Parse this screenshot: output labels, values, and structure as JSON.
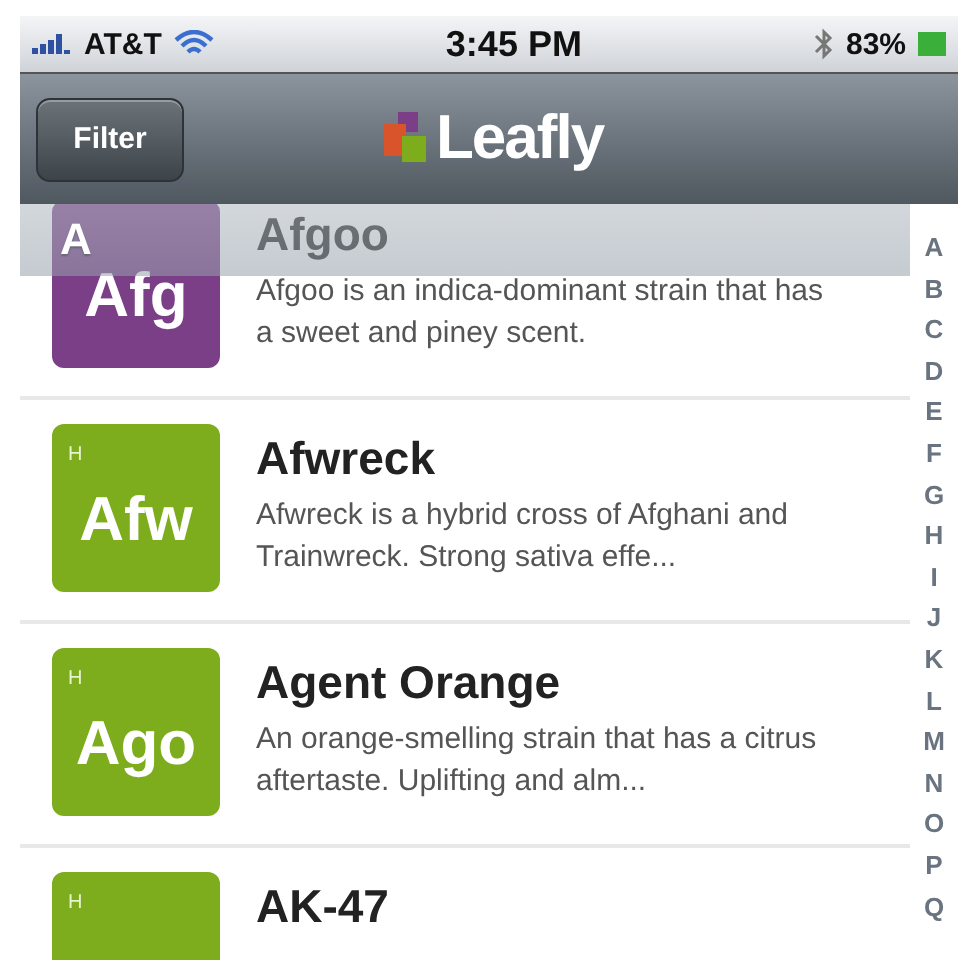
{
  "status_bar": {
    "carrier": "AT&T",
    "time": "3:45 PM",
    "battery": "83%"
  },
  "nav_bar": {
    "filter_button": "Filter",
    "logo_text": "Leafly"
  },
  "section_header": "A",
  "strains": [
    {
      "abbr": "Afg",
      "name": "Afgoo",
      "description": "Afgoo is an indica-dominant strain that has a sweet and piney scent.",
      "color": "#7b3f88"
    },
    {
      "type": "H",
      "abbr": "Afw",
      "name": "Afwreck",
      "description": "Afwreck is a hybrid cross of Afghani and Trainwreck.  Strong sativa effe...",
      "color": "#7dac1c"
    },
    {
      "type": "H",
      "abbr": "Ago",
      "name": "Agent Orange",
      "description": "An orange-smelling strain that has a citrus aftertaste.  Uplifting and alm...",
      "color": "#7dac1c"
    },
    {
      "type": "H",
      "name": "AK-47",
      "color": "#7dac1c"
    }
  ],
  "index": [
    "A",
    "B",
    "C",
    "D",
    "E",
    "F",
    "G",
    "H",
    "I",
    "J",
    "K",
    "L",
    "M",
    "N",
    "O",
    "P",
    "Q"
  ]
}
